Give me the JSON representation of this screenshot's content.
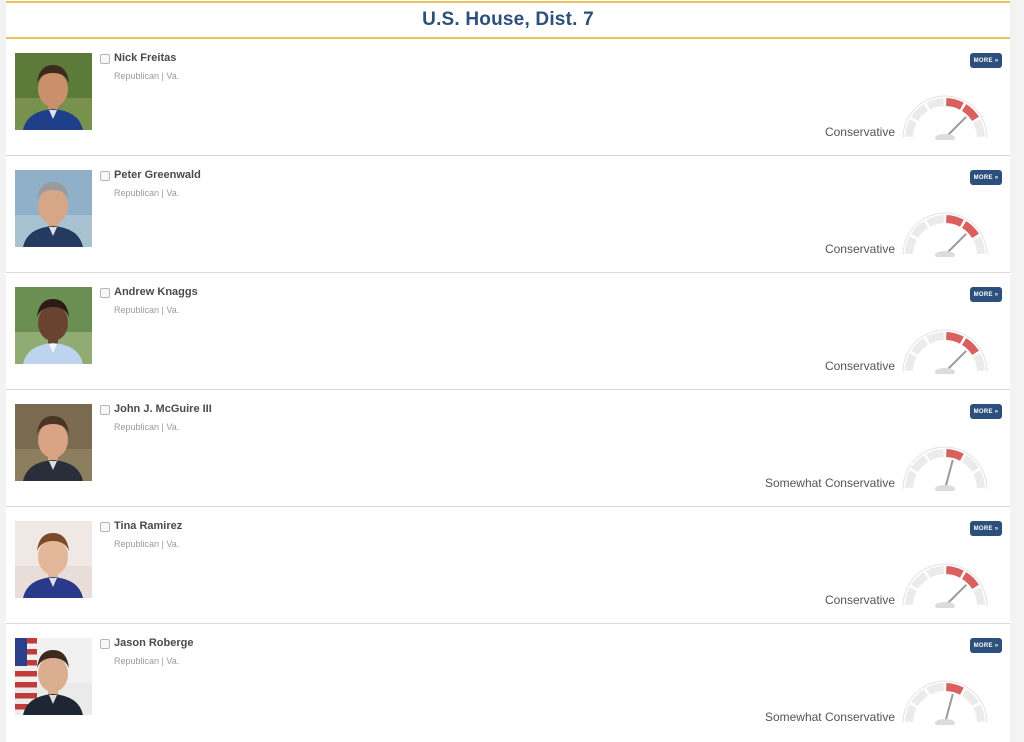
{
  "header": {
    "title": "U.S. House, Dist. 7"
  },
  "more_label": "MORE »",
  "candidates": [
    {
      "name": "Nick Freitas",
      "party_state": "Republican | Va.",
      "ideology": "Conservative",
      "gauge_level": 4
    },
    {
      "name": "Peter Greenwald",
      "party_state": "Republican | Va.",
      "ideology": "Conservative",
      "gauge_level": 4
    },
    {
      "name": "Andrew Knaggs",
      "party_state": "Republican | Va.",
      "ideology": "Conservative",
      "gauge_level": 4
    },
    {
      "name": "John J. McGuire III",
      "party_state": "Republican | Va.",
      "ideology": "Somewhat Conservative",
      "gauge_level": 3
    },
    {
      "name": "Tina Ramirez",
      "party_state": "Republican | Va.",
      "ideology": "Conservative",
      "gauge_level": 4
    },
    {
      "name": "Jason Roberge",
      "party_state": "Republican | Va.",
      "ideology": "Somewhat Conservative",
      "gauge_level": 3
    }
  ],
  "colors": {
    "accent": "#2d4f7c",
    "header_rule": "#e8c25a",
    "gauge_active": "#d9605e",
    "gauge_inactive": "#ebebeb"
  }
}
